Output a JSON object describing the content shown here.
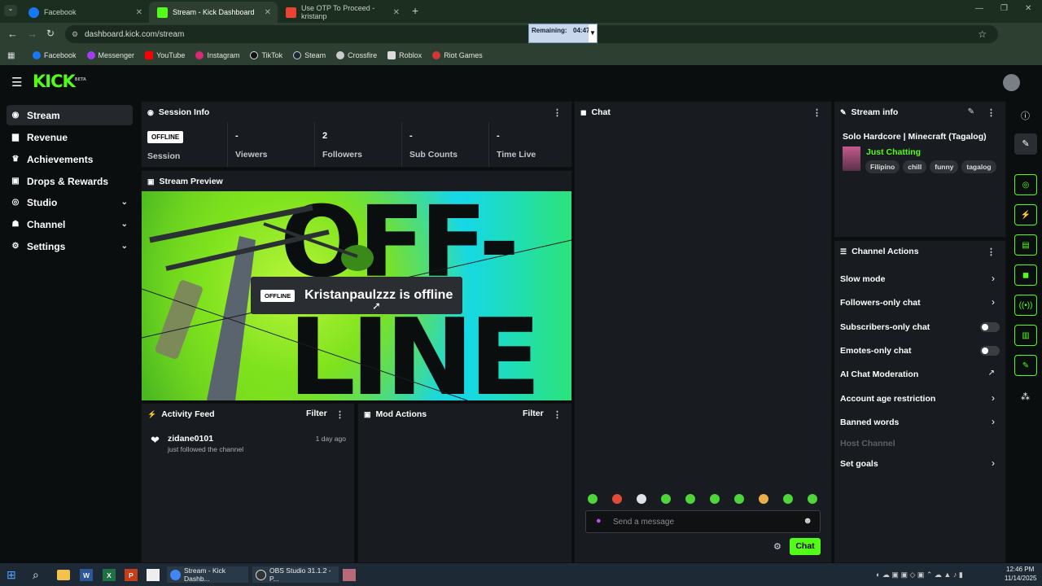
{
  "browser": {
    "tabs": [
      {
        "label": "Facebook"
      },
      {
        "label": "Stream - Kick Dashboard"
      },
      {
        "label": "Use OTP To Proceed - kristanp"
      }
    ],
    "url": "dashboard.kick.com/stream",
    "bookmarks": [
      "Facebook",
      "Messenger",
      "YouTube",
      "Instagram",
      "TikTok",
      "Steam",
      "Crossfire",
      "Roblox",
      "Riot Games"
    ]
  },
  "timer": {
    "label": "Remaining:",
    "value": "04:47"
  },
  "kick": {
    "logo": "KICK",
    "beta": "BETA"
  },
  "sidebar": {
    "items": [
      {
        "label": "Stream"
      },
      {
        "label": "Revenue"
      },
      {
        "label": "Achievements"
      },
      {
        "label": "Drops & Rewards"
      },
      {
        "label": "Studio"
      },
      {
        "label": "Channel"
      },
      {
        "label": "Settings"
      }
    ]
  },
  "session": {
    "title": "Session Info",
    "badge": "OFFLINE",
    "badge_label": "Session",
    "stats": [
      {
        "value": "-",
        "label": "Viewers"
      },
      {
        "value": "2",
        "label": "Followers"
      },
      {
        "value": "-",
        "label": "Sub Counts"
      },
      {
        "value": "-",
        "label": "Time Live"
      }
    ]
  },
  "preview": {
    "title": "Stream Preview",
    "big1": "OFF-",
    "big2": "LINE",
    "badge": "OFFLINE",
    "message": "Kristanpaulzzz is offline"
  },
  "activity": {
    "title": "Activity Feed",
    "filter": "Filter",
    "user": "zidane0101",
    "action": "just followed the channel",
    "time": "1 day ago"
  },
  "mod": {
    "title": "Mod Actions",
    "filter": "Filter"
  },
  "chat": {
    "title": "Chat",
    "placeholder": "Send a message",
    "button": "Chat"
  },
  "stream_info": {
    "title": "Stream info",
    "stream_title": "Solo Hardcore | Minecraft (Tagalog)",
    "category": "Just Chatting",
    "tags": [
      "Filipino",
      "chill",
      "funny",
      "tagalog"
    ]
  },
  "channel_actions": {
    "title": "Channel Actions",
    "items": [
      "Slow mode",
      "Followers-only chat",
      "Subscribers-only chat",
      "Emotes-only chat",
      "AI Chat Moderation",
      "Account age restriction",
      "Banned words",
      "Host Channel",
      "Set goals"
    ]
  },
  "taskbar": {
    "items": [
      "Stream - Kick Dashb...",
      "OBS Studio 31.1.2 - P..."
    ],
    "time": "12:46 PM",
    "date": "11/14/2025"
  },
  "colors": {
    "accent": "#53fc18",
    "bg": "#0b0e0f",
    "panel": "#181b1f"
  }
}
